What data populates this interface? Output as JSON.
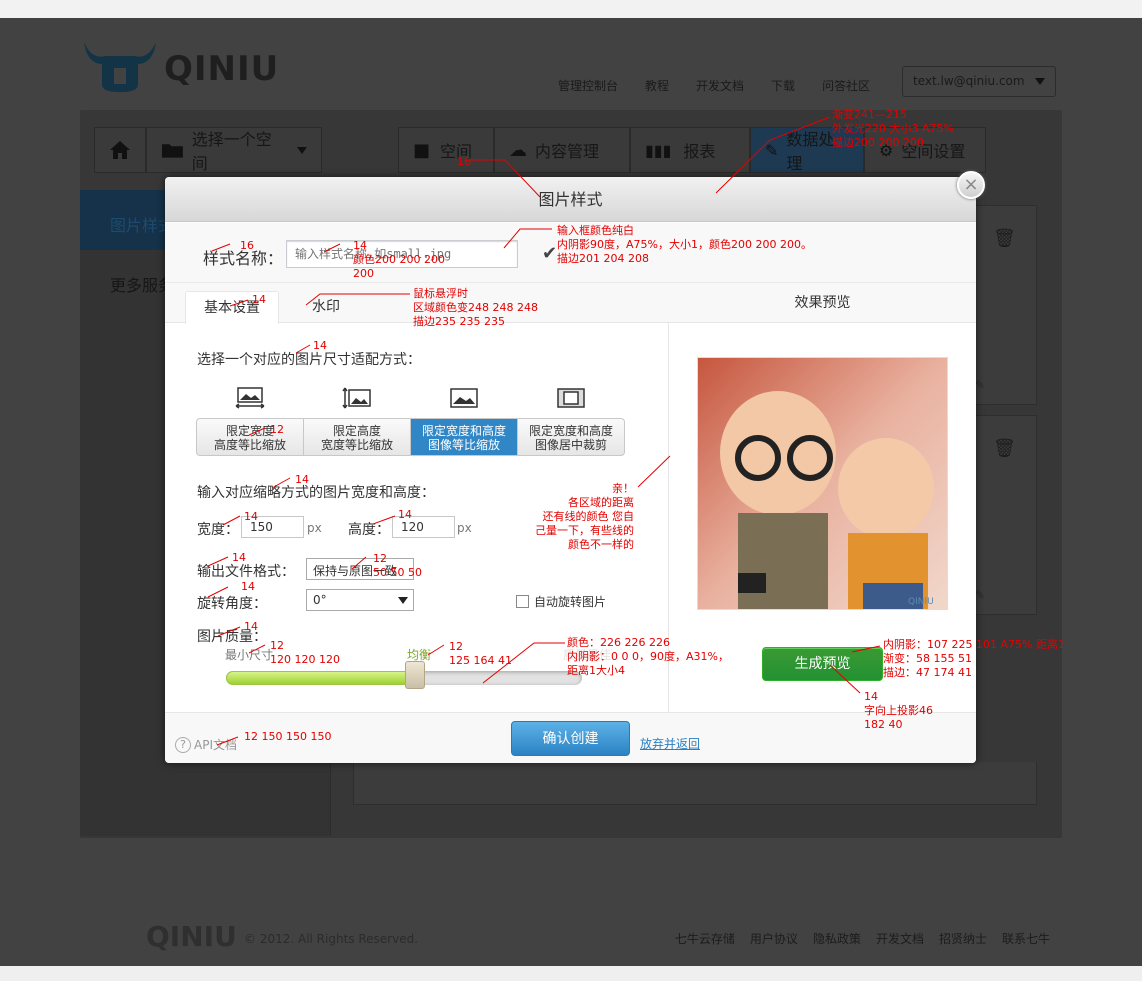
{
  "brand": {
    "name": "QINIU"
  },
  "topnav": [
    "管理控制台",
    "教程",
    "开发文档",
    "下载",
    "问答社区"
  ],
  "user": {
    "email": "text.lw@qiniu.com"
  },
  "toolbar": {
    "select_space": "选择一个空间"
  },
  "navtabs": [
    "空间",
    "内容管理",
    "报表",
    "数据处理",
    "空间设置"
  ],
  "sidebar": {
    "selected": "图片样式",
    "more": "更多服务"
  },
  "modal": {
    "title": "图片样式",
    "name_label": "样式名称：",
    "name_placeholder": "输入样式名称,如small.jpg",
    "tabs": [
      "基本设置",
      "水印"
    ],
    "fit_title": "选择一个对应的图片尺寸适配方式：",
    "fit_options": [
      {
        "l1": "限定宽度",
        "l2": "高度等比缩放"
      },
      {
        "l1": "限定高度",
        "l2": "宽度等比缩放"
      },
      {
        "l1": "限定宽度和高度",
        "l2": "图像等比缩放"
      },
      {
        "l1": "限定宽度和高度",
        "l2": "图像居中裁剪"
      }
    ],
    "size_title": "输入对应缩略方式的图片宽度和高度：",
    "width_label": "宽度：",
    "width_value": "150",
    "width_unit": "px",
    "height_label": "高度：",
    "height_value": "120",
    "height_unit": "px",
    "format_label": "输出文件格式：",
    "format_value": "保持与原图一致",
    "rotate_label": "旋转角度：",
    "rotate_value": "0°",
    "autorotate_label": "自动旋转图片",
    "quality_label": "图片质量：",
    "quality_min": "最小尺寸",
    "quality_mid": "均衡",
    "quality_max": "质量最佳",
    "quality_level": 0.53,
    "preview_title": "效果预览",
    "generate_button": "生成预览",
    "api_doc": "API文档",
    "confirm_button": "确认创建",
    "cancel_link": "放弃并返回",
    "watermark": "QINIU"
  },
  "footer": {
    "copyright": "© 2012. All Rights Reserved.",
    "links": [
      "七牛云存储",
      "用户协议",
      "隐私政策",
      "开发文档",
      "招贤纳士",
      "联系七牛"
    ]
  },
  "annotations": {
    "a1": [
      "渐变241—215",
      "外发光220  大小3 A75%",
      "描边200 200 200"
    ],
    "a2": "16",
    "a3": "16",
    "a4": [
      "14",
      "颜色200 200 200",
      "200"
    ],
    "a5": [
      "输入框颜色纯白",
      "内阴影90度，A75%，大小1，颜色200 200 200。",
      "描边201 204 208"
    ],
    "a6": "14",
    "a7": [
      "鼠标悬浮时",
      "区域颜色变248 248 248",
      "描边235 235 235"
    ],
    "a8": "14",
    "a9": "12",
    "a10": "14",
    "a11": "14",
    "a12": "14",
    "a13": "14",
    "a14": [
      "12",
      "50 50 50"
    ],
    "a15": "14",
    "a16": "14",
    "a17": [
      "12",
      "120 120 120"
    ],
    "a18": [
      "12",
      "125 164 41"
    ],
    "a19": [
      "颜色：226 226 226",
      "内阴影：0 0 0，90度，A31%，",
      "距离1大小4"
    ],
    "a20": [
      "亲！",
      "各区域的距离",
      "还有线的颜色  您自",
      "己量一下，有些线的",
      "颜色不一样的"
    ],
    "a21": [
      "内阴影：107 225 101 A75% 距离1",
      "渐变：58 155 51",
      "描边：47 174 41"
    ],
    "a22": [
      "14",
      "字向上投影46",
      "182 40"
    ],
    "a23": "12 150 150 150"
  }
}
